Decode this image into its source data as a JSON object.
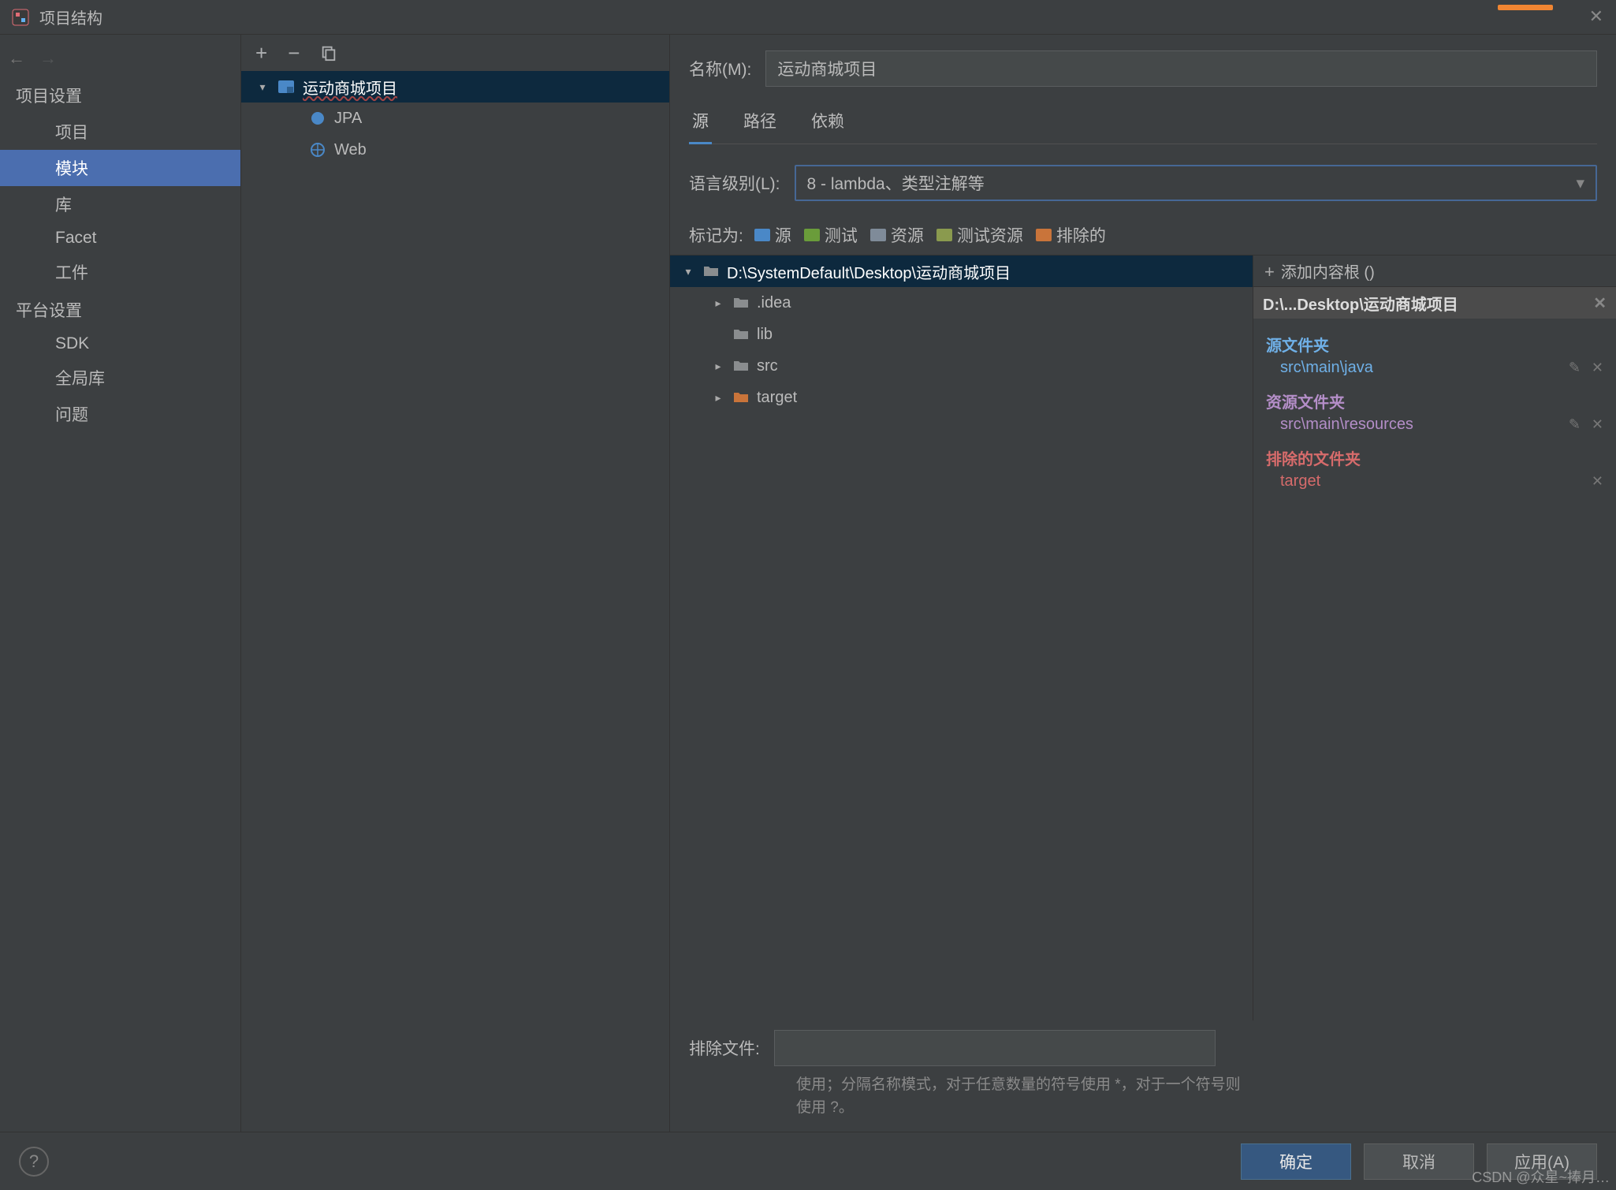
{
  "titlebar": {
    "title": "项目结构"
  },
  "sidebar": {
    "sections": [
      {
        "heading": "项目设置",
        "items": [
          "项目",
          "模块",
          "库",
          "Facet",
          "工件"
        ],
        "selected": 1
      },
      {
        "heading": "平台设置",
        "items": [
          "SDK",
          "全局库"
        ],
        "selected": -1
      },
      {
        "heading": "",
        "items": [
          "问题"
        ],
        "selected": -1
      }
    ]
  },
  "module_tree": {
    "root": "运动商城项目",
    "children": [
      "JPA",
      "Web"
    ]
  },
  "form": {
    "name_label": "名称(M):",
    "name_value": "运动商城项目",
    "tabs": [
      "源",
      "路径",
      "依赖"
    ],
    "active_tab": 0,
    "lang_label": "语言级别(L):",
    "lang_value": "8 - lambda、类型注解等",
    "mark_label": "标记为:",
    "marks": [
      {
        "label": "源",
        "color": "#4a88c7"
      },
      {
        "label": "测试",
        "color": "#6a9c3a"
      },
      {
        "label": "资源",
        "color": "#7f8b99"
      },
      {
        "label": "测试资源",
        "color": "#8a9a4e"
      },
      {
        "label": "排除的",
        "color": "#c9743a"
      }
    ],
    "exclude_label": "排除文件:",
    "exclude_value": "",
    "hint": "使用；分隔名称模式，对于任意数量的符号使用 *，对于一个符号则使用 ?。"
  },
  "folder_tree": {
    "root": "D:\\SystemDefault\\Desktop\\运动商城项目",
    "children": [
      {
        "name": ".idea",
        "expandable": true,
        "color": "#8a8d8f"
      },
      {
        "name": "lib",
        "expandable": false,
        "color": "#8a8d8f"
      },
      {
        "name": "src",
        "expandable": true,
        "color": "#8a8d8f"
      },
      {
        "name": "target",
        "expandable": true,
        "color": "#c9743a"
      }
    ]
  },
  "content_roots": {
    "add_label": "添加内容根 ()",
    "path": "D:\\...Desktop\\运动商城项目",
    "groups": [
      {
        "title": "源文件夹",
        "klass": "src",
        "entries": [
          {
            "path": "src\\main\\java",
            "color": "#6fb0e7",
            "editable": true
          }
        ]
      },
      {
        "title": "资源文件夹",
        "klass": "res",
        "entries": [
          {
            "path": "src\\main\\resources",
            "color": "#b48ec8",
            "editable": true
          }
        ]
      },
      {
        "title": "排除的文件夹",
        "klass": "exc",
        "entries": [
          {
            "path": "target",
            "color": "#d66b6b",
            "editable": false
          }
        ]
      }
    ]
  },
  "buttons": {
    "ok": "确定",
    "cancel": "取消",
    "apply": "应用(A)"
  },
  "watermark": "CSDN @众星~捧月…"
}
